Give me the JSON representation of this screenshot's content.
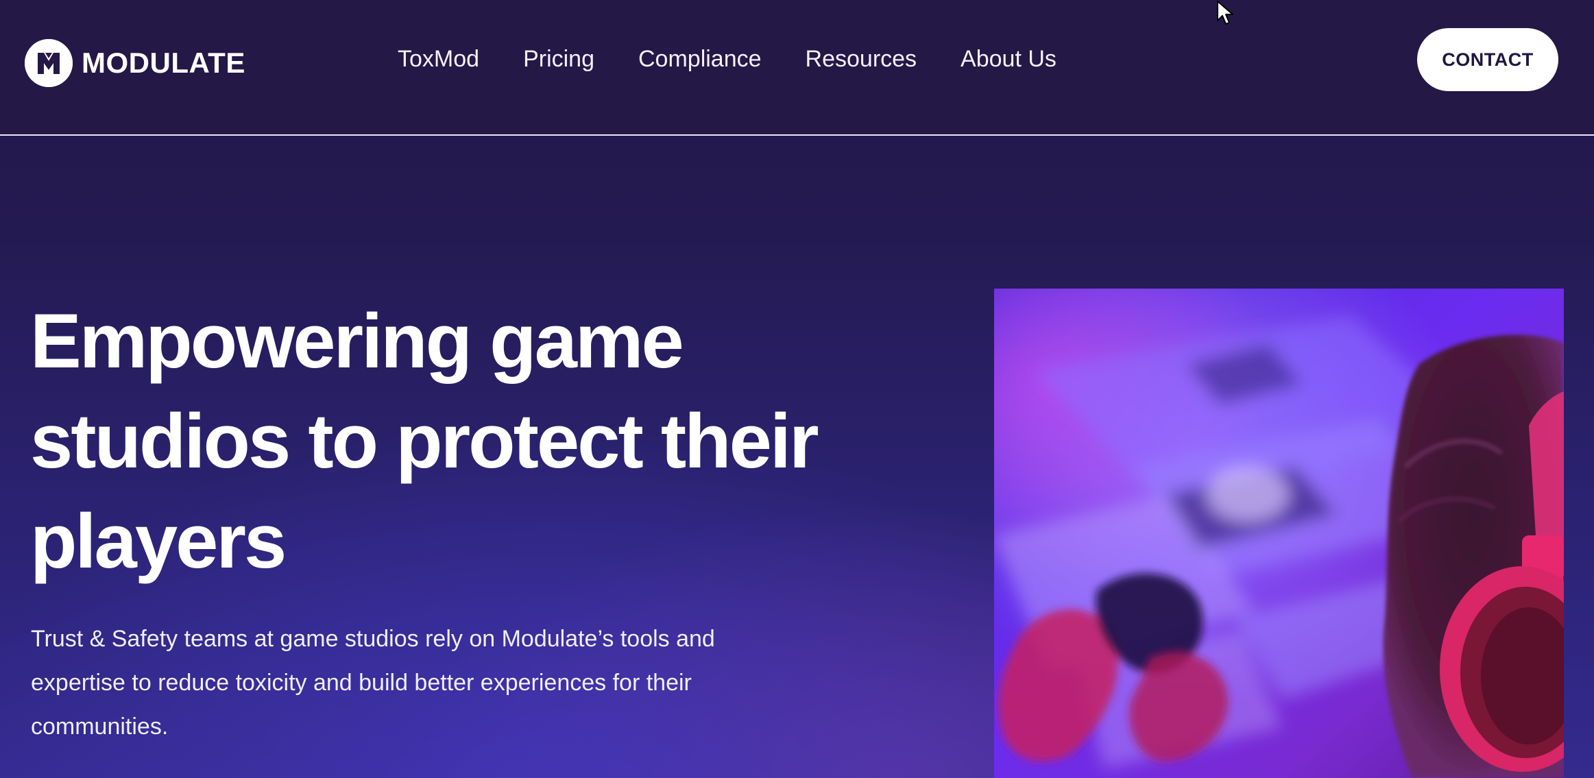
{
  "brand": {
    "name": "MODULATE",
    "logo_icon": "modulate-m-logo-icon"
  },
  "nav": {
    "items": [
      {
        "label": "ToxMod"
      },
      {
        "label": "Pricing"
      },
      {
        "label": "Compliance"
      },
      {
        "label": "Resources"
      },
      {
        "label": "About Us"
      }
    ]
  },
  "header": {
    "contact_label": "CONTACT"
  },
  "hero": {
    "title": "Empowering game studios to protect their players",
    "subtitle": "Trust & Safety teams at game studios rely on Modulate’s tools and expertise to reduce toxicity and build better experiences for their communities.",
    "image_subject": "gamer-with-headphones-photo"
  },
  "colors": {
    "header_bg": "#241847",
    "accent_purple": "#5a1fd0",
    "button_bg": "#ffffff",
    "button_text": "#1f1640"
  }
}
